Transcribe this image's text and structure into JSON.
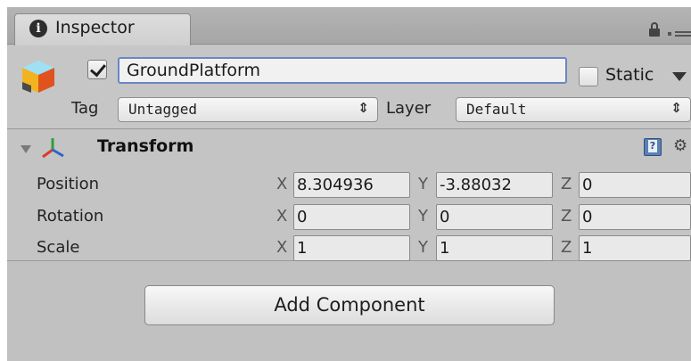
{
  "tab": {
    "title": "Inspector",
    "info_glyph": "i"
  },
  "header": {
    "object_name": "GroundPlatform",
    "active": true,
    "static_label": "Static",
    "static": false,
    "tag_label": "Tag",
    "tag_value": "Untagged",
    "layer_label": "Layer",
    "layer_value": "Default",
    "select_arrows": "⇕"
  },
  "transform": {
    "title": "Transform",
    "rows": [
      {
        "label": "Position",
        "x": "8.304936",
        "y": "-3.88032",
        "z": "0"
      },
      {
        "label": "Rotation",
        "x": "0",
        "y": "0",
        "z": "0"
      },
      {
        "label": "Scale",
        "x": "1",
        "y": "1",
        "z": "1"
      }
    ],
    "axes": {
      "x": "X",
      "y": "Y",
      "z": "Z"
    }
  },
  "add_component_label": "Add Component",
  "icons": {
    "tab": "info-icon",
    "lock": "lock-icon",
    "menu": "tab-menu-icon",
    "object": "gameobject-cube-icon",
    "transform": "transform-axes-icon",
    "help": "help-book-icon",
    "settings": "gear-icon"
  },
  "colors": {
    "name_focus_border": "#6a86c4",
    "panel": "#c2c2c2"
  }
}
